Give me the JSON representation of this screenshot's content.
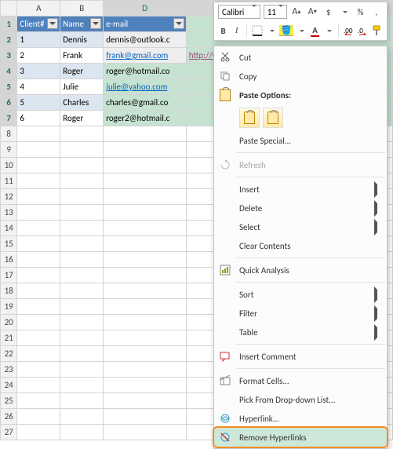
{
  "columns": [
    "A",
    "B",
    "D"
  ],
  "row_numbers": [
    1,
    2,
    3,
    4,
    5,
    6,
    7,
    8,
    9,
    10,
    11,
    12,
    13,
    14,
    15,
    16,
    17,
    18,
    19,
    20,
    21,
    22,
    23,
    24,
    25,
    26,
    27
  ],
  "table": {
    "headers": [
      "Client#",
      "Name",
      "e-mail"
    ],
    "rows": [
      {
        "client": "1",
        "name": "Dennis",
        "email": "dennis@outlook.c",
        "link": false
      },
      {
        "client": "2",
        "name": "Frank",
        "email": "frank@gmail.com",
        "link": true
      },
      {
        "client": "3",
        "name": "Roger",
        "email": "roger@hotmail.co",
        "link": false
      },
      {
        "client": "4",
        "name": "Julie",
        "email": "julie@yahoo.com",
        "link": true
      },
      {
        "client": "5",
        "name": "Charles",
        "email": "charles@gmail.co",
        "link": false
      },
      {
        "client": "6",
        "name": "Roger",
        "email": "roger2@hotmail.c",
        "link": false
      }
    ]
  },
  "cell_link_visited": "http://www.ablebits.com",
  "mini_toolbar": {
    "font": "Calibri",
    "size": "11",
    "bold": "B",
    "italic": "I",
    "inc_font": "A",
    "dec_font": "A",
    "currency": "$",
    "percent": "%",
    "comma": ","
  },
  "context_menu": {
    "cut": "Cut",
    "copy": "Copy",
    "paste_options": "Paste Options:",
    "paste_special": "Paste Special...",
    "refresh": "Refresh",
    "insert": "Insert",
    "delete": "Delete",
    "select": "Select",
    "clear_contents": "Clear Contents",
    "quick_analysis": "Quick Analysis",
    "sort": "Sort",
    "filter": "Filter",
    "table": "Table",
    "insert_comment": "Insert Comment",
    "format_cells": "Format Cells...",
    "pick_list": "Pick From Drop-down List...",
    "hyperlink": "Hyperlink...",
    "remove_hyperlinks": "Remove Hyperlinks"
  }
}
